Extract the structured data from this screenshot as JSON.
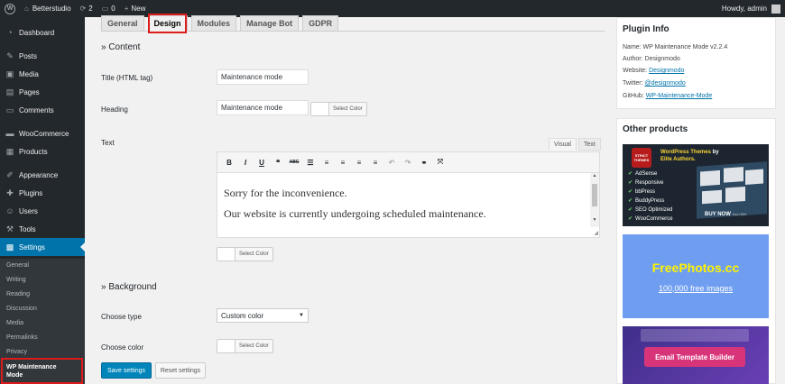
{
  "adminbar": {
    "site_name": "Betterstudio",
    "updates_count": "2",
    "comments_count": "0",
    "new_label": "New",
    "howdy": "Howdy, admin"
  },
  "sidebar": {
    "items": [
      {
        "label": "Dashboard",
        "icon": "dashboard-icon"
      },
      {
        "label": "Posts",
        "icon": "pin-icon"
      },
      {
        "label": "Media",
        "icon": "media-icon"
      },
      {
        "label": "Pages",
        "icon": "pages-icon"
      },
      {
        "label": "Comments",
        "icon": "comment-icon"
      },
      {
        "label": "WooCommerce",
        "icon": "woocommerce-icon"
      },
      {
        "label": "Products",
        "icon": "products-icon"
      },
      {
        "label": "Appearance",
        "icon": "brush-icon"
      },
      {
        "label": "Plugins",
        "icon": "plugin-icon"
      },
      {
        "label": "Users",
        "icon": "users-icon"
      },
      {
        "label": "Tools",
        "icon": "wrench-icon"
      },
      {
        "label": "Settings",
        "icon": "settings-icon"
      }
    ],
    "submenu": [
      "General",
      "Writing",
      "Reading",
      "Discussion",
      "Media",
      "Permalinks",
      "Privacy",
      "WP Maintenance Mode"
    ]
  },
  "tabs": [
    "General",
    "Design",
    "Modules",
    "Manage Bot",
    "GDPR"
  ],
  "content": {
    "section_content": "» Content",
    "title_label": "Title (HTML tag)",
    "title_value": "Maintenance mode",
    "heading_label": "Heading",
    "heading_value": "Maintenance mode",
    "select_color": "Select Color",
    "text_label": "Text",
    "editor_tab_visual": "Visual",
    "editor_tab_text": "Text",
    "editor_paragraphs": [
      "Sorry for the inconvenience.",
      "Our website is currently undergoing scheduled maintenance."
    ],
    "section_background": "» Background",
    "choose_type_label": "Choose type",
    "choose_type_value": "Custom color",
    "choose_color_label": "Choose color",
    "save_button": "Save settings",
    "reset_button": "Reset settings"
  },
  "plugin_info": {
    "title": "Plugin Info",
    "name": "Name: WP Maintenance Mode v2.2.4",
    "author": "Author: Designmodo",
    "website_prefix": "Website: ",
    "website_link": "Designmodo",
    "twitter_prefix": "Twitter: ",
    "twitter_link": "@designmodo",
    "github_prefix": "GitHub: ",
    "github_link": "WP-Maintenance-Mode"
  },
  "other_products": {
    "title": "Other products",
    "banner1_logo": "STRICT THEMES",
    "banner1_headline_a": "WordPress Themes",
    "banner1_headline_b": " by",
    "banner1_headline_c": "Elite Authors.",
    "banner1_features": [
      "AdSense",
      "Responsive",
      "bbPress",
      "BuddyPress",
      "SEO Optimized",
      "WooCommerce"
    ],
    "banner1_cta": "BUY NOW",
    "banner1_cta_small": "from $59",
    "banner2_title": "FreePhotos.cc",
    "banner2_sub": "100,000 free images",
    "banner3_button": "Email Template Builder"
  },
  "colors": {
    "wp_dark": "#23282d",
    "wp_blue": "#0073aa",
    "highlight_red": "#dd1b1b"
  }
}
